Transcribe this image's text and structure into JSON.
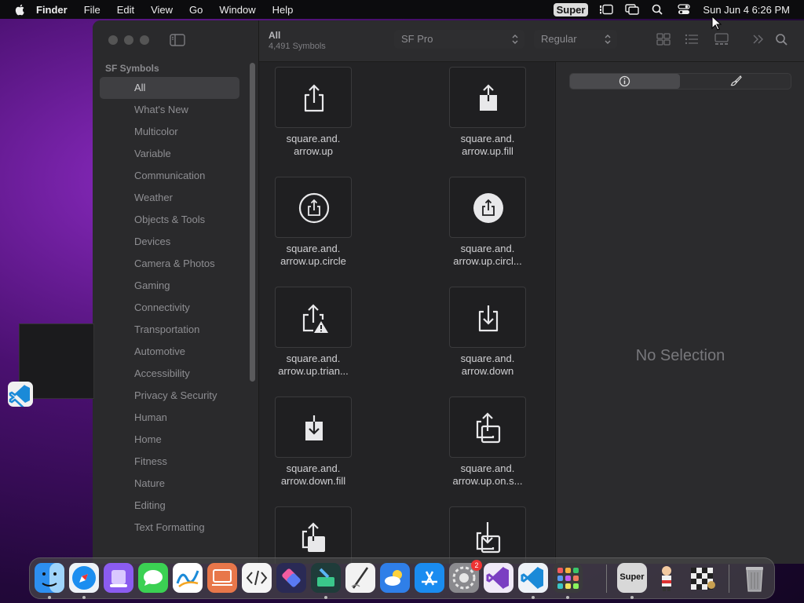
{
  "menubar": {
    "items": [
      "Finder",
      "File",
      "Edit",
      "View",
      "Go",
      "Window",
      "Help"
    ],
    "super_badge": "Super",
    "clock": "Sun Jun 4  6:26 PM"
  },
  "sidebar": {
    "section": "SF Symbols",
    "items": [
      {
        "label": "All",
        "selected": true
      },
      {
        "label": "What's New"
      },
      {
        "label": "Multicolor"
      },
      {
        "label": "Variable"
      },
      {
        "label": "Communication"
      },
      {
        "label": "Weather"
      },
      {
        "label": "Objects & Tools"
      },
      {
        "label": "Devices"
      },
      {
        "label": "Camera & Photos"
      },
      {
        "label": "Gaming"
      },
      {
        "label": "Connectivity"
      },
      {
        "label": "Transportation"
      },
      {
        "label": "Automotive"
      },
      {
        "label": "Accessibility"
      },
      {
        "label": "Privacy & Security"
      },
      {
        "label": "Human"
      },
      {
        "label": "Home"
      },
      {
        "label": "Fitness"
      },
      {
        "label": "Nature"
      },
      {
        "label": "Editing"
      },
      {
        "label": "Text Formatting"
      }
    ]
  },
  "toolbar": {
    "title": "All",
    "count": "4,491 Symbols",
    "font_popup": "SF Pro",
    "weight_popup": "Regular"
  },
  "symbols": [
    {
      "name_line1": "square.and.",
      "name_line2": "arrow.up",
      "icon": "square-arrow-up-icon"
    },
    {
      "name_line1": "square.and.",
      "name_line2": "arrow.up.fill",
      "icon": "square-arrow-up-fill-icon"
    },
    {
      "name_line1": "square.and.",
      "name_line2": "arrow.up.circle",
      "icon": "square-arrow-up-circle-icon"
    },
    {
      "name_line1": "square.and.",
      "name_line2": "arrow.up.circl...",
      "icon": "square-arrow-up-circle-fill-icon"
    },
    {
      "name_line1": "square.and.",
      "name_line2": "arrow.up.trian...",
      "icon": "square-arrow-up-triangle-icon"
    },
    {
      "name_line1": "square.and.",
      "name_line2": "arrow.down",
      "icon": "square-arrow-down-icon"
    },
    {
      "name_line1": "square.and.",
      "name_line2": "arrow.down.fill",
      "icon": "square-arrow-down-fill-icon"
    },
    {
      "name_line1": "square.and.",
      "name_line2": "arrow.up.on.s...",
      "icon": "square-arrow-up-on-square-icon"
    }
  ],
  "inspector": {
    "empty_text": "No Selection"
  },
  "dock": {
    "super_label": "Super",
    "settings_badge": "2"
  }
}
